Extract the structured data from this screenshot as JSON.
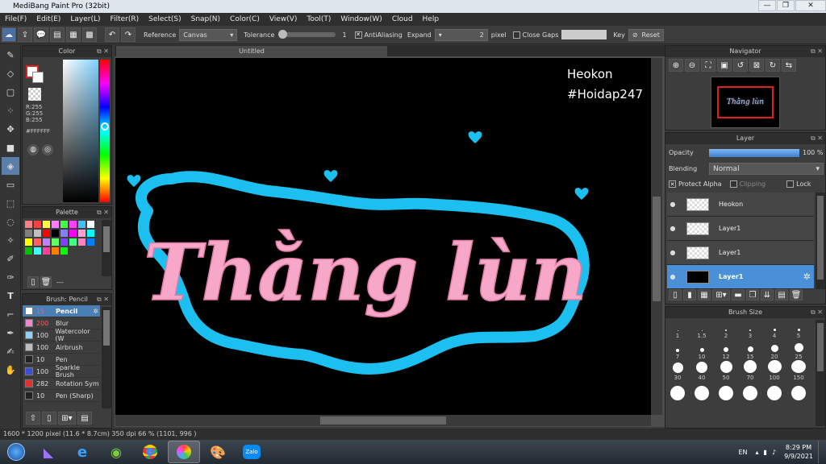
{
  "window": {
    "title": "MediBang Paint Pro (32bit)",
    "minimize": "—",
    "maximize": "❐",
    "close": "✕"
  },
  "menu": [
    "File(F)",
    "Edit(E)",
    "Layer(L)",
    "Filter(R)",
    "Select(S)",
    "Snap(N)",
    "Color(C)",
    "View(V)",
    "Tool(T)",
    "Window(W)",
    "Cloud",
    "Help"
  ],
  "toolbar": {
    "reference_label": "Reference",
    "reference_value": "Canvas",
    "tolerance_label": "Tolerance",
    "tolerance_value": "1",
    "antialiasing_label": "AntiAliasing",
    "expand_label": "Expand",
    "expand_value": "2",
    "expand_unit": "pixel",
    "close_gaps_label": "Close Gaps",
    "key_label": "Key",
    "reset_label": "Reset"
  },
  "color_panel": {
    "title": "Color",
    "r": "R:255",
    "g": "G:255",
    "b": "B:255",
    "hex": "#FFFFFF"
  },
  "palette_panel": {
    "title": "Palette",
    "dash": "---"
  },
  "brush_panel": {
    "title": "Brush: Pencil",
    "items": [
      {
        "size": "15",
        "name": "Pencil",
        "color": "#ffffff"
      },
      {
        "size": "200",
        "name": "Blur",
        "color": "#e88ccf"
      },
      {
        "size": "100",
        "name": "Watercolor (W",
        "color": "#8fd3f5"
      },
      {
        "size": "100",
        "name": "Airbrush",
        "color": "#bdbdbd"
      },
      {
        "size": "10",
        "name": "Pen",
        "color": "#222222"
      },
      {
        "size": "100",
        "name": "Sparkle Brush",
        "color": "#3a4fd8"
      },
      {
        "size": "282",
        "name": "Rotation Sym",
        "color": "#e03030"
      },
      {
        "size": "10",
        "name": "Pen (Sharp)",
        "color": "#222222"
      }
    ]
  },
  "canvas": {
    "tab_title": "Untitled",
    "artwork_text": "Thằng lùn",
    "watermark_line1": "Heokon",
    "watermark_line2": "#Hoidap247"
  },
  "navigator": {
    "title": "Navigator",
    "thumb_text": "Thằng lùn"
  },
  "layer_panel": {
    "title": "Layer",
    "opacity_label": "Opacity",
    "opacity_value": "100 %",
    "opacity_fraction": 1.0,
    "blending_label": "Blending",
    "blending_value": "Normal",
    "protect_alpha_label": "Protect Alpha",
    "clipping_label": "Clipping",
    "lock_label": "Lock",
    "layers": [
      {
        "name": "Heokon",
        "selected": false
      },
      {
        "name": "Layer1",
        "selected": false
      },
      {
        "name": "Layer1",
        "selected": false
      },
      {
        "name": "Layer1",
        "selected": true
      }
    ]
  },
  "brush_size": {
    "title": "Brush Size",
    "sizes": [
      "1",
      "1.5",
      "2",
      "3",
      "4",
      "5",
      "7",
      "10",
      "12",
      "15",
      "20",
      "25",
      "30",
      "40",
      "50",
      "70",
      "100",
      "150"
    ]
  },
  "status": {
    "text": "1600 * 1200 pixel  (11.6 * 8.7cm)  350 dpi  66 %  (1101, 996 )"
  },
  "taskbar": {
    "lang": "EN",
    "time": "8:29 PM",
    "date": "9/9/2021",
    "zalo": "Zalo"
  },
  "colors": {
    "accent": "#4a90d9",
    "outline": "#1cc0f0",
    "lettering": "#f7a8c8",
    "canvas_bg": "#000000"
  }
}
